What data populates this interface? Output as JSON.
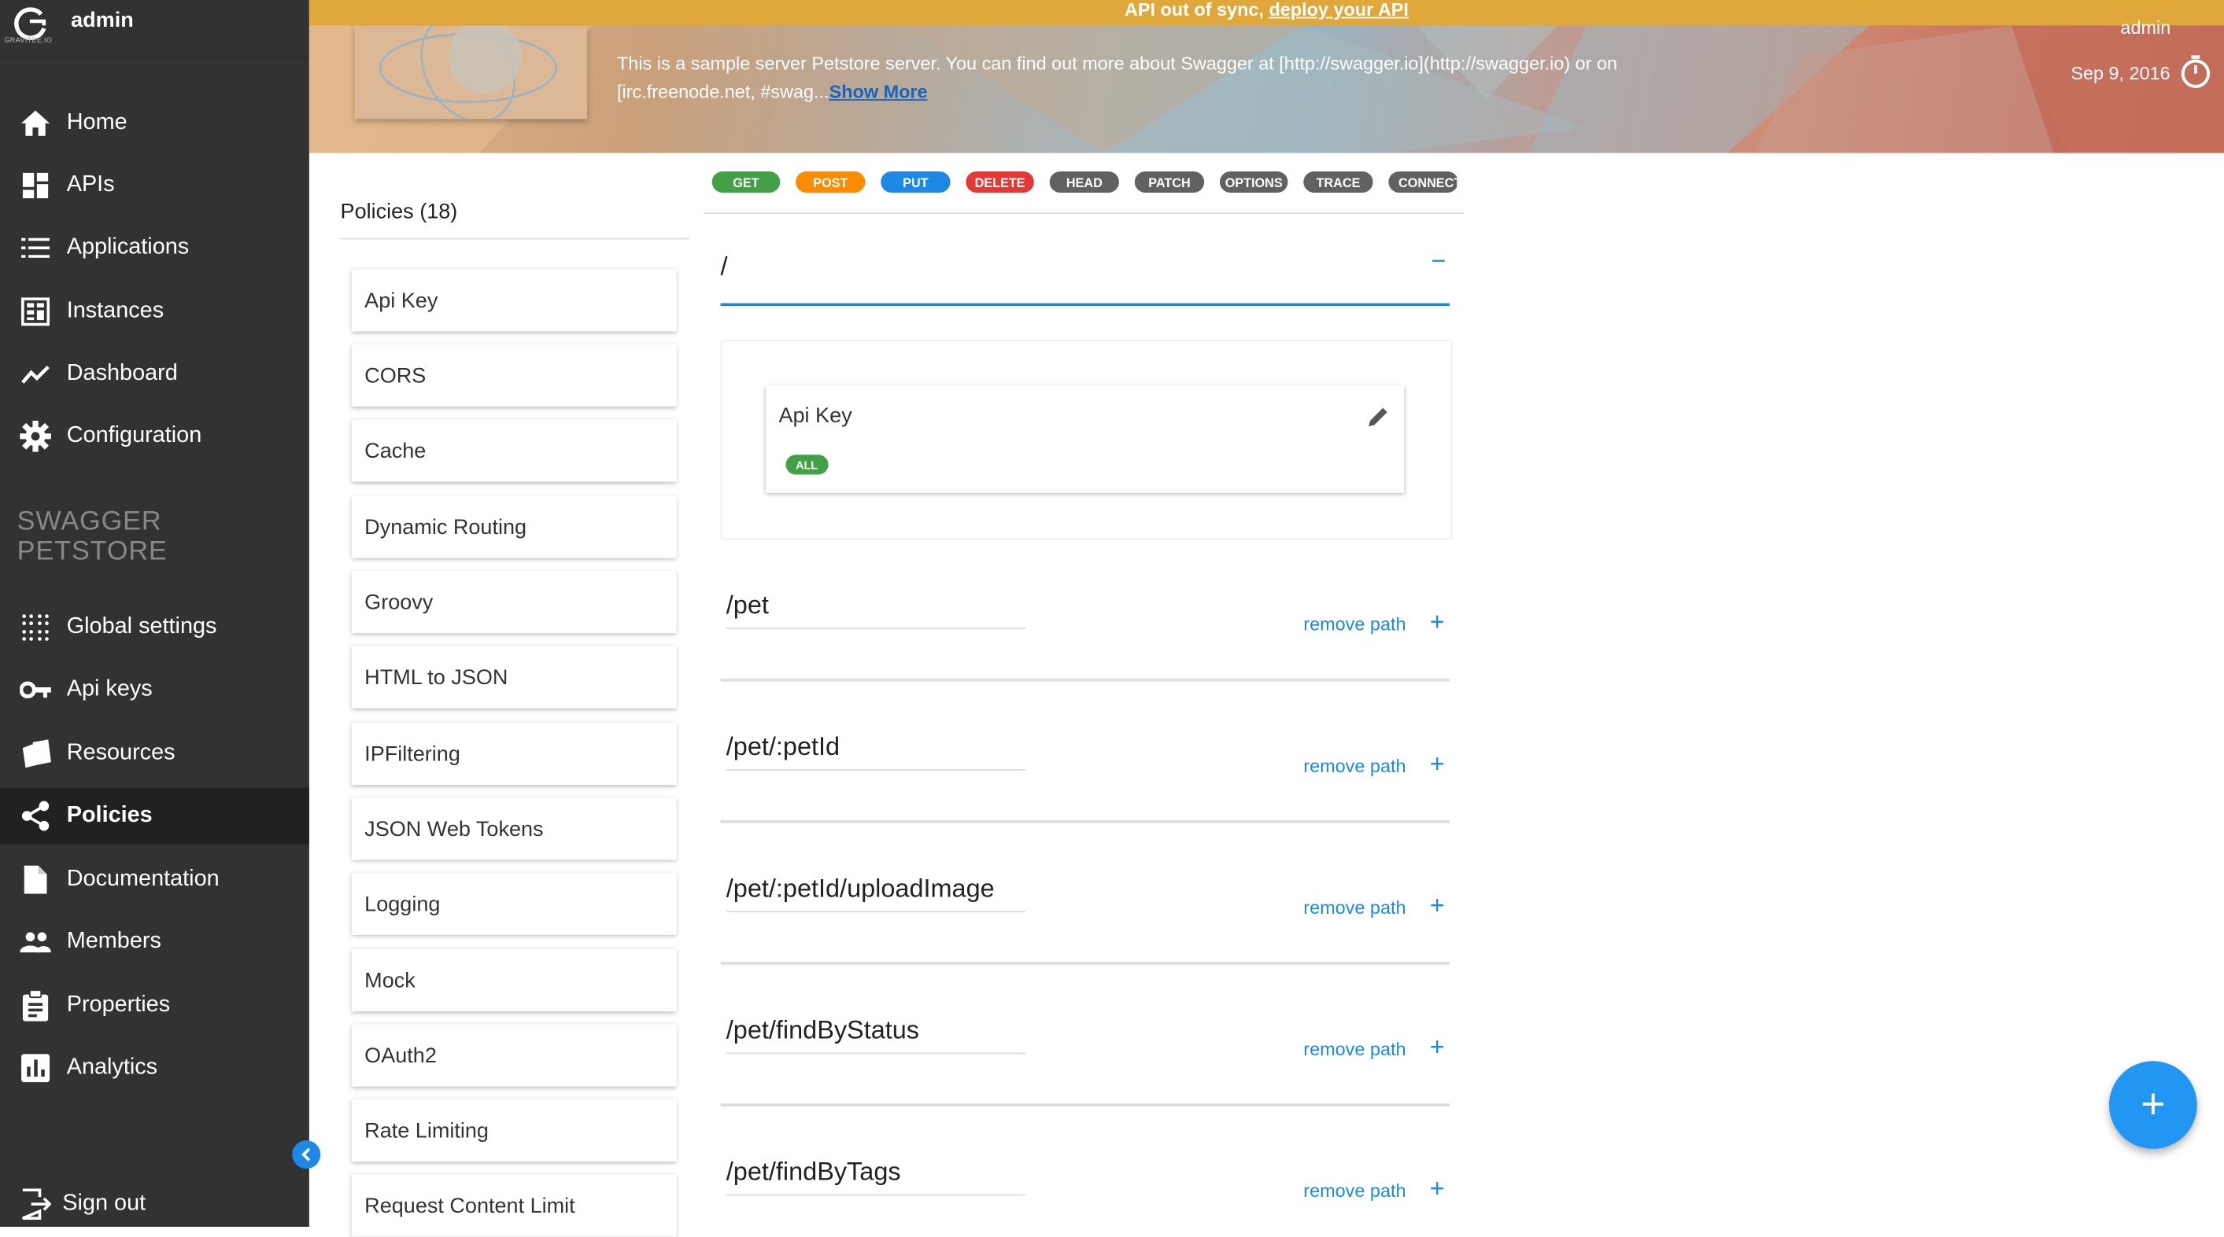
{
  "user": {
    "name": "admin",
    "logo_text": "GRAVITEE.IO"
  },
  "nav": {
    "items": [
      {
        "label": "Home",
        "icon": "home-icon"
      },
      {
        "label": "APIs",
        "icon": "dashboard-grid-icon"
      },
      {
        "label": "Applications",
        "icon": "list-icon"
      },
      {
        "label": "Instances",
        "icon": "instances-icon"
      },
      {
        "label": "Dashboard",
        "icon": "trending-line-icon"
      },
      {
        "label": "Configuration",
        "icon": "gear-icon"
      }
    ],
    "section_title_line1": "SWAGGER",
    "section_title_line2": "PETSTORE",
    "api_items": [
      {
        "label": "Global settings",
        "icon": "dots-grid-icon"
      },
      {
        "label": "Api keys",
        "icon": "key-icon"
      },
      {
        "label": "Resources",
        "icon": "cards-icon"
      },
      {
        "label": "Policies",
        "icon": "share-icon",
        "active": true
      },
      {
        "label": "Documentation",
        "icon": "file-icon"
      },
      {
        "label": "Members",
        "icon": "people-icon"
      },
      {
        "label": "Properties",
        "icon": "clipboard-icon"
      },
      {
        "label": "Analytics",
        "icon": "bar-chart-icon"
      }
    ],
    "sign_out": "Sign out"
  },
  "header": {
    "sync_text": "API out of sync, ",
    "sync_link": "deploy your API",
    "description": "This is a sample server Petstore server. You can find out more about Swagger at [http://swagger.io](http://swagger.io) or on [irc.freenode.net, #swag...",
    "show_more": "Show More",
    "date": "Sep 9, 2016",
    "admin": "admin"
  },
  "policies": {
    "title": "Policies (18)",
    "items": [
      "Api Key",
      "CORS",
      "Cache",
      "Dynamic Routing",
      "Groovy",
      "HTML to JSON",
      "IPFiltering",
      "JSON Web Tokens",
      "Logging",
      "Mock",
      "OAuth2",
      "Rate Limiting",
      "Request Content Limit"
    ]
  },
  "methods": [
    {
      "label": "GET",
      "color": "#43a047"
    },
    {
      "label": "POST",
      "color": "#fb8c00"
    },
    {
      "label": "PUT",
      "color": "#1e88e5"
    },
    {
      "label": "DELETE",
      "color": "#e53935"
    },
    {
      "label": "HEAD",
      "color": "#616161"
    },
    {
      "label": "PATCH",
      "color": "#616161"
    },
    {
      "label": "OPTIONS",
      "color": "#616161"
    },
    {
      "label": "TRACE",
      "color": "#616161"
    },
    {
      "label": "CONNECT",
      "color": "#616161"
    }
  ],
  "root_path": {
    "path": "/",
    "collapse": "−",
    "policy": {
      "name": "Api Key",
      "badge": "ALL"
    }
  },
  "paths": [
    {
      "path": "/pet",
      "remove": "remove path",
      "add": "+"
    },
    {
      "path": "/pet/:petId",
      "remove": "remove path",
      "add": "+"
    },
    {
      "path": "/pet/:petId/uploadImage",
      "remove": "remove path",
      "add": "+"
    },
    {
      "path": "/pet/findByStatus",
      "remove": "remove path",
      "add": "+"
    },
    {
      "path": "/pet/findByTags",
      "remove": "remove path",
      "add": "+"
    }
  ],
  "fab": "+"
}
